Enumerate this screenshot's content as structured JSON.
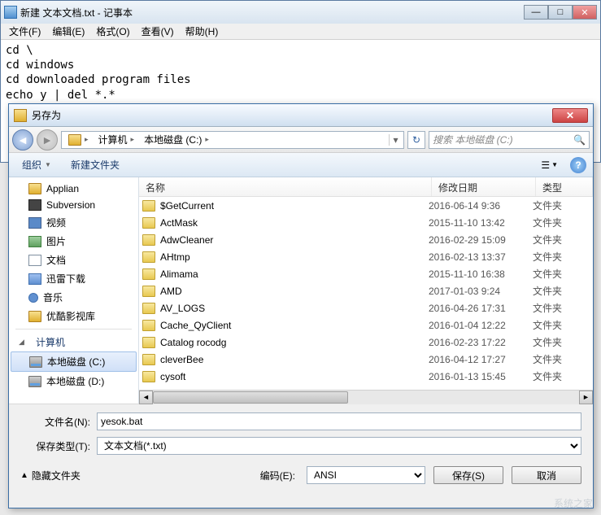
{
  "notepad": {
    "title": "新建 文本文档.txt - 记事本",
    "menu": {
      "file": "文件(F)",
      "edit": "编辑(E)",
      "format": "格式(O)",
      "view": "查看(V)",
      "help": "帮助(H)"
    },
    "content": "cd \\\ncd windows\ncd downloaded program files\necho y | del *.*"
  },
  "dialog": {
    "title": "另存为",
    "breadcrumb": {
      "computer": "计算机",
      "drive": "本地磁盘 (C:)"
    },
    "search_placeholder": "搜索 本地磁盘 (C:)",
    "toolbar": {
      "organize": "组织",
      "newfolder": "新建文件夹"
    },
    "sidebar": {
      "items": [
        {
          "label": "Applian",
          "kind": "folder"
        },
        {
          "label": "Subversion",
          "kind": "subv"
        },
        {
          "label": "视频",
          "kind": "video"
        },
        {
          "label": "图片",
          "kind": "pic"
        },
        {
          "label": "文档",
          "kind": "doc"
        },
        {
          "label": "迅雷下载",
          "kind": "dl"
        },
        {
          "label": "音乐",
          "kind": "music"
        },
        {
          "label": "优酷影视库",
          "kind": "folder"
        }
      ],
      "computer_label": "计算机",
      "drives": [
        {
          "label": "本地磁盘 (C:)",
          "selected": true
        },
        {
          "label": "本地磁盘 (D:)",
          "selected": false
        }
      ]
    },
    "columns": {
      "name": "名称",
      "date": "修改日期",
      "type": "类型"
    },
    "files": [
      {
        "name": "$GetCurrent",
        "date": "2016-06-14 9:36",
        "type": "文件夹"
      },
      {
        "name": "ActMask",
        "date": "2015-11-10 13:42",
        "type": "文件夹"
      },
      {
        "name": "AdwCleaner",
        "date": "2016-02-29 15:09",
        "type": "文件夹"
      },
      {
        "name": "AHtmp",
        "date": "2016-02-13 13:37",
        "type": "文件夹"
      },
      {
        "name": "Alimama",
        "date": "2015-11-10 16:38",
        "type": "文件夹"
      },
      {
        "name": "AMD",
        "date": "2017-01-03 9:24",
        "type": "文件夹"
      },
      {
        "name": "AV_LOGS",
        "date": "2016-04-26 17:31",
        "type": "文件夹"
      },
      {
        "name": "Cache_QyClient",
        "date": "2016-01-04 12:22",
        "type": "文件夹"
      },
      {
        "name": "Catalog rocodg",
        "date": "2016-02-23 17:22",
        "type": "文件夹"
      },
      {
        "name": "cleverBee",
        "date": "2016-04-12 17:27",
        "type": "文件夹"
      },
      {
        "name": "cysoft",
        "date": "2016-01-13 15:45",
        "type": "文件夹"
      }
    ],
    "filename_label": "文件名(N):",
    "filename_value": "yesok.bat",
    "savetype_label": "保存类型(T):",
    "savetype_value": "文本文档(*.txt)",
    "hide_folders": "隐藏文件夹",
    "encoding_label": "编码(E):",
    "encoding_value": "ANSI",
    "save_btn": "保存(S)",
    "cancel_btn": "取消"
  },
  "watermark": "系统之家"
}
